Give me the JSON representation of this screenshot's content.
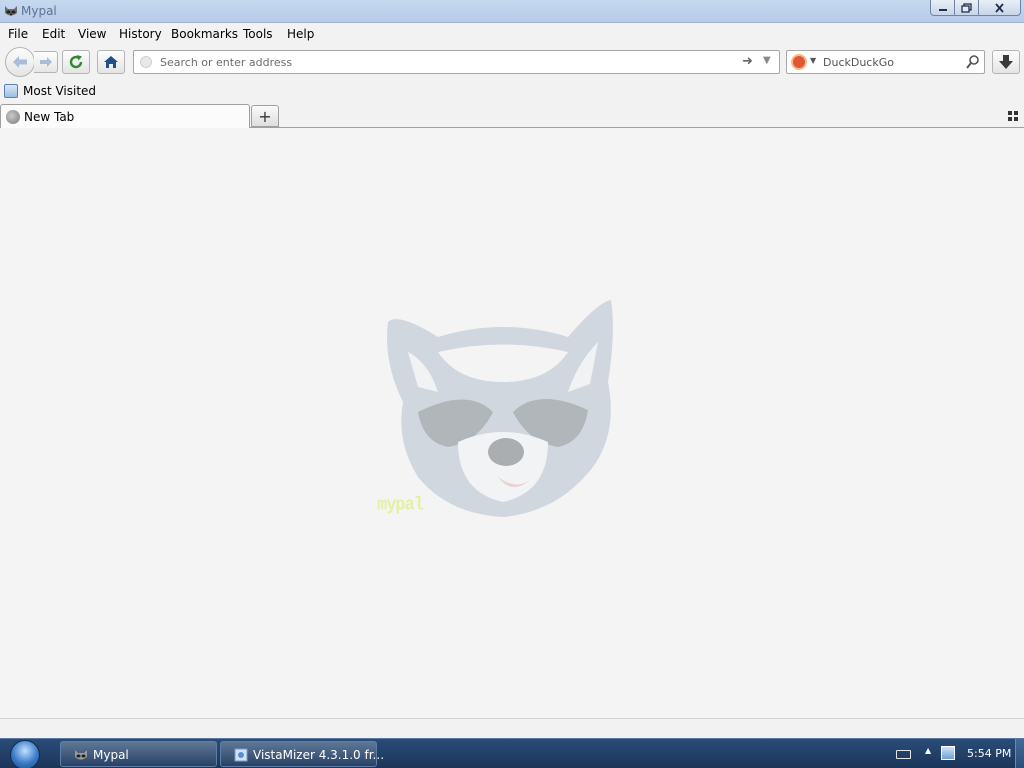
{
  "window": {
    "title": "Mypal",
    "icons": {
      "app": "raccoon-icon",
      "minimize": "minimize-icon",
      "maximize": "restore-icon",
      "close": "close-icon"
    }
  },
  "menubar": {
    "items": [
      {
        "label": "File"
      },
      {
        "label": "Edit"
      },
      {
        "label": "View"
      },
      {
        "label": "History"
      },
      {
        "label": "Bookmarks"
      },
      {
        "label": "Tools"
      },
      {
        "label": "Help"
      }
    ]
  },
  "navbar": {
    "address": {
      "value": "",
      "placeholder": "Search or enter address"
    },
    "search": {
      "value": "",
      "placeholder": "DuckDuckGo",
      "engine_icon": "duckduckgo-icon"
    },
    "icons": [
      "back-arrow-icon",
      "forward-arrow-icon",
      "reload-icon",
      "home-icon",
      "go-arrow-icon",
      "dropdown-icon",
      "magnifier-icon",
      "download-icon"
    ]
  },
  "bookmarks": {
    "items": [
      {
        "label": "Most Visited",
        "icon": "bookmark-folder-icon"
      }
    ]
  },
  "tabs": {
    "items": [
      {
        "label": "New Tab",
        "icon": "globe-icon",
        "active": true
      }
    ],
    "new_tab_icon": "plus-icon",
    "all_tabs_icon": "grid-icon"
  },
  "content": {
    "mascot_label": "mypal",
    "mascot_icon": "raccoon-face-icon"
  },
  "taskbar": {
    "tasks": [
      {
        "label": "Mypal",
        "icon": "raccoon-icon"
      },
      {
        "label": "VistaMizer 4.3.1.0 fr...",
        "icon": "installer-icon"
      }
    ],
    "tray_icons": [
      "keyboard-icon",
      "show-hidden-icon",
      "network-icon"
    ],
    "clock": "5:54 PM"
  },
  "colors": {
    "titlebar": "#c0d4ef",
    "chrome": "#f2f2f2",
    "content_bg": "#f4f4f4",
    "taskbar": "#203f68",
    "duckduckgo": "#de5833"
  }
}
